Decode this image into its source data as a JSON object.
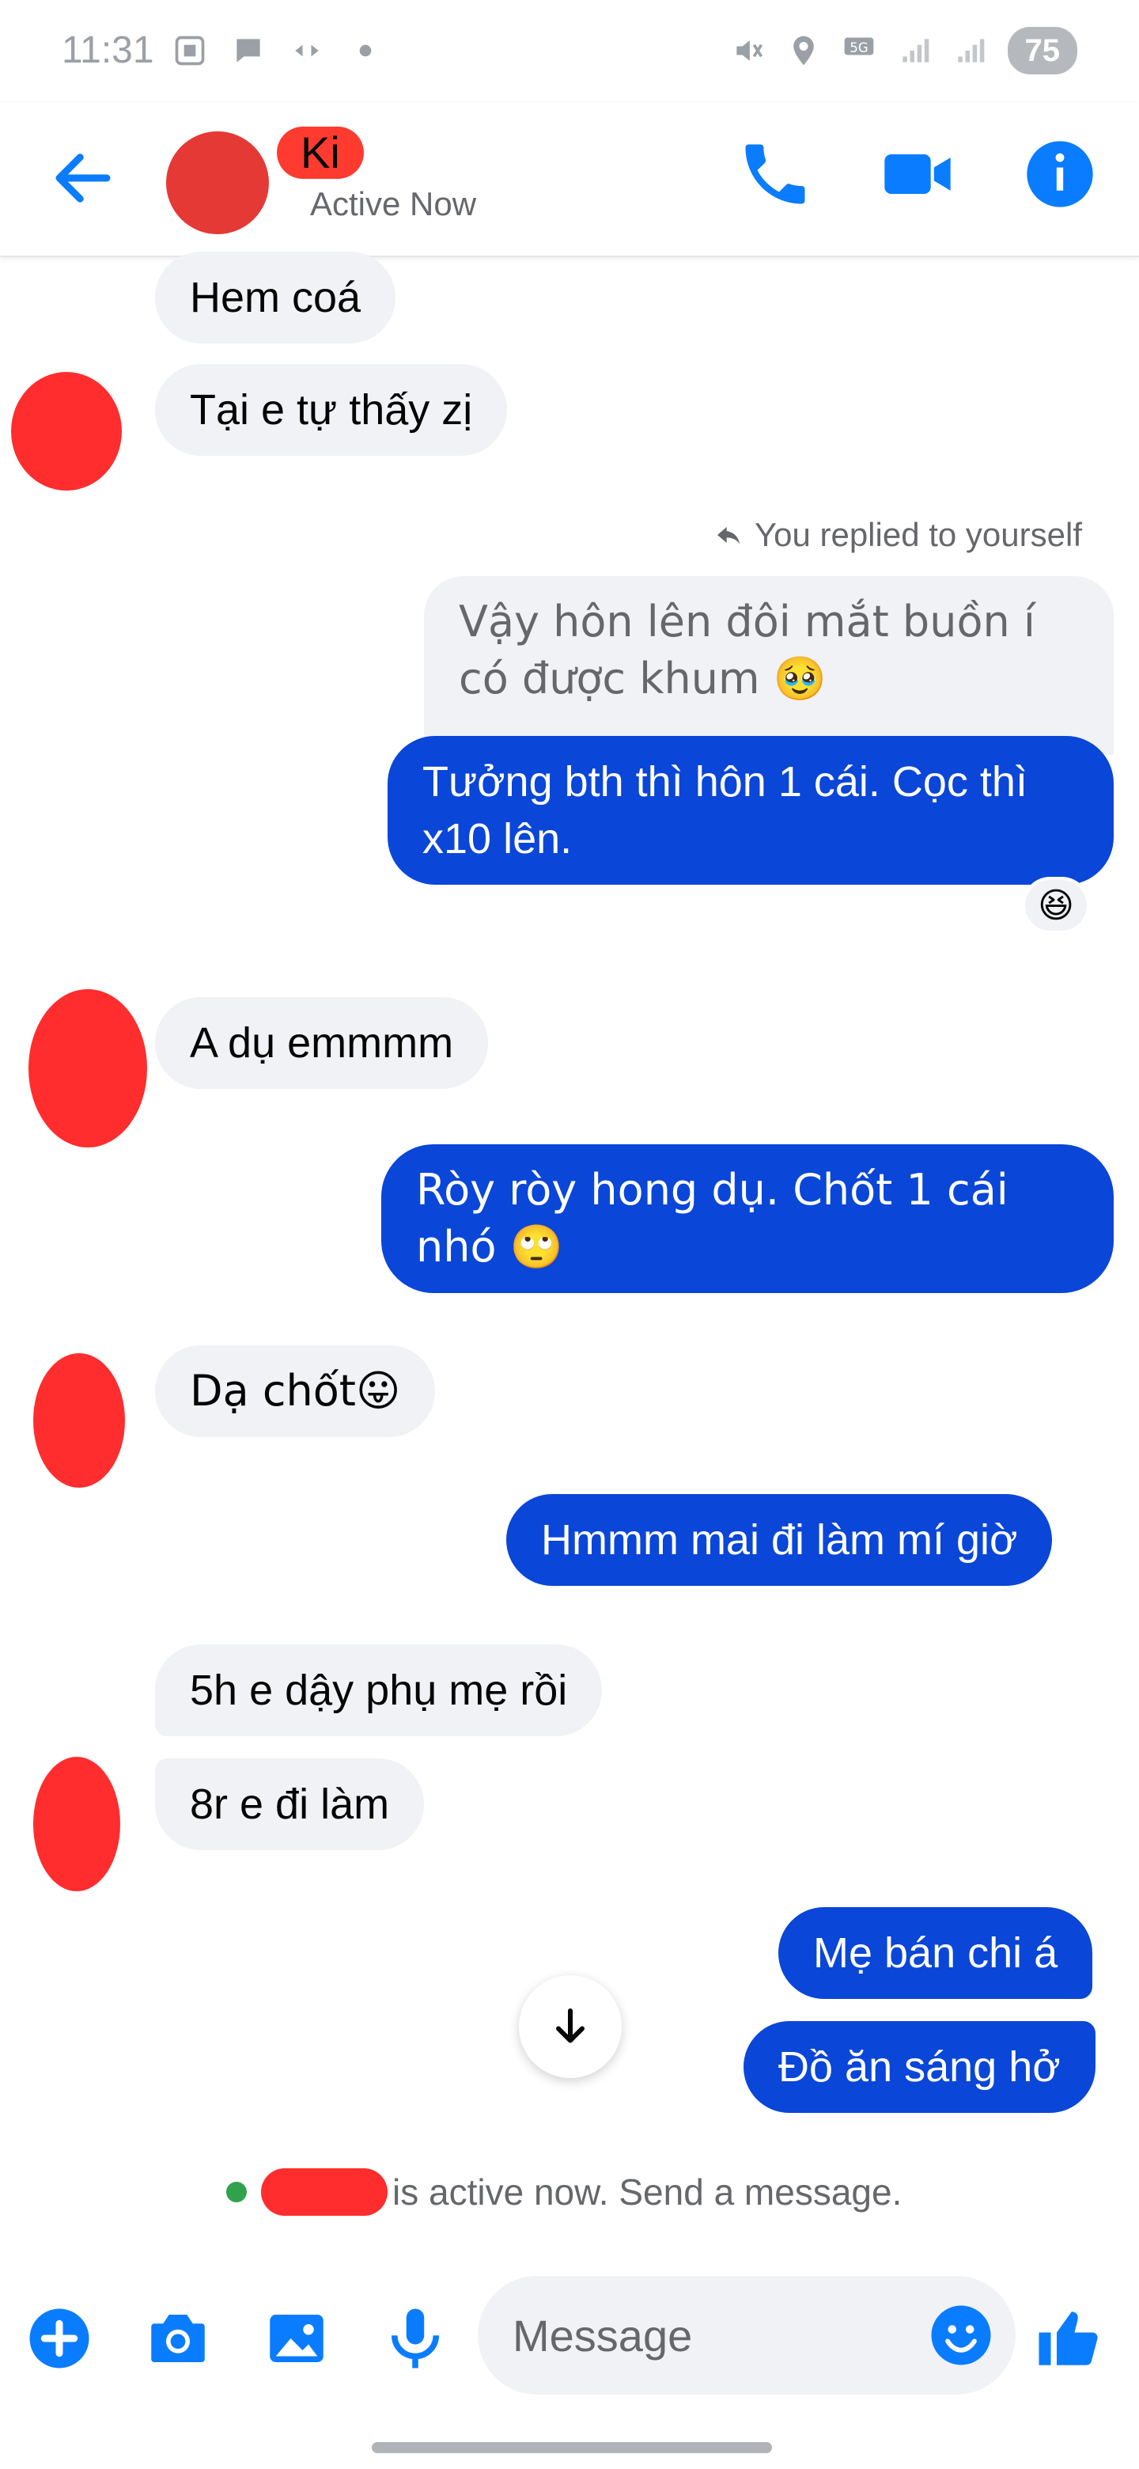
{
  "status_bar": {
    "time": "11:31",
    "battery": "75"
  },
  "header": {
    "contact_name": "Ki",
    "active_status": "Active Now"
  },
  "messages": {
    "m1": "Hem coá",
    "m2": "Tại e tự thấy zị",
    "reply_note": "You replied to yourself",
    "m3_quoted": "Vậy hôn lên đôi mắt buồn í có được khum 🥹",
    "m4": "Tưởng bth thì hôn 1 cái. Cọc thì x10 lên.",
    "m4_reaction": "😆",
    "m5": "A dụ emmmm",
    "m6": "Ròy ròy hong dụ. Chốt 1 cái nhó 🙄",
    "m7": "Dạ chốt😛",
    "m8": "Hmmm mai đi làm mí giờ",
    "m9": "5h e dậy phụ mẹ rồi",
    "m10": "8r e đi làm",
    "m11": "Mẹ bán chi á",
    "m12": "Đồ ăn sáng hở"
  },
  "active_line": "is active now. Send a message.",
  "composer": {
    "placeholder": "Message"
  },
  "colors": {
    "accent": "#0a7cff",
    "outgoing": "#0a46d8",
    "incoming": "#f0f2f5",
    "online": "#31a24c"
  }
}
